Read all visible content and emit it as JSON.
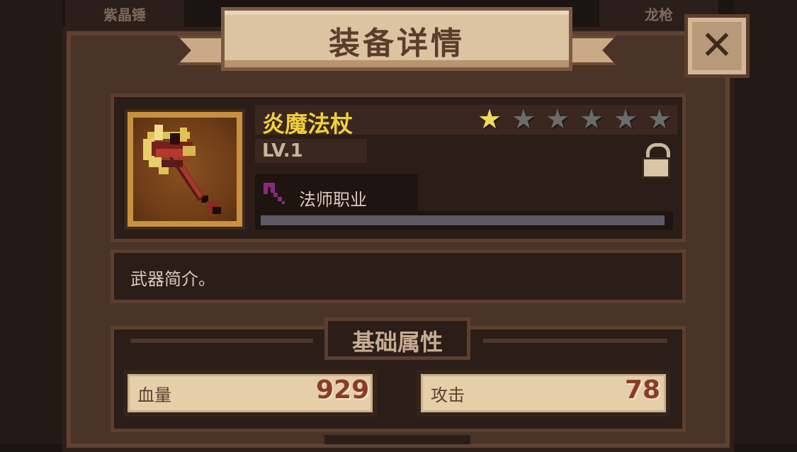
{
  "background_tabs": [
    "紫晶锤",
    "龙枪"
  ],
  "header": {
    "title": "装备详情",
    "close_icon": "close-x-icon"
  },
  "item": {
    "name": "炎魔法杖",
    "level": "LV.1",
    "stars_total": 6,
    "stars_filled": 1,
    "class_label": "法师职业",
    "class_icon": "staff-icon",
    "lock_icon": "lock-icon",
    "progress": 0
  },
  "description": "武器简介。",
  "base_stats": {
    "title": "基础属性",
    "items": [
      {
        "label": "血量",
        "value": "929"
      },
      {
        "label": "攻击",
        "value": "78"
      }
    ]
  },
  "colors": {
    "name": "#f2cf3a",
    "star_on": "#f2d95e",
    "star_off": "#6b6b6b",
    "staff_accent": "#8a2a7e"
  }
}
